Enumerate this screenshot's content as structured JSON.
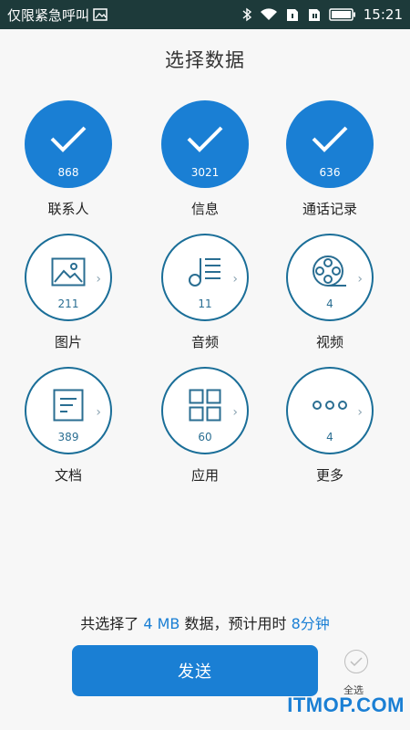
{
  "status_bar": {
    "left_text": "仅限紧急呼叫",
    "time": "15:21",
    "icons": [
      "image-icon",
      "bluetooth-icon",
      "wifi-icon",
      "sim1-icon",
      "sim2-icon",
      "battery-icon"
    ]
  },
  "title": "选择数据",
  "items": [
    {
      "label": "联系人",
      "count": "868",
      "state": "checked",
      "icon": "check-icon"
    },
    {
      "label": "信息",
      "count": "3021",
      "state": "checked",
      "icon": "check-icon"
    },
    {
      "label": "通话记录",
      "count": "636",
      "state": "checked",
      "icon": "check-icon"
    },
    {
      "label": "图片",
      "count": "211",
      "state": "unchecked",
      "icon": "picture-icon"
    },
    {
      "label": "音频",
      "count": "11",
      "state": "unchecked",
      "icon": "music-icon"
    },
    {
      "label": "视频",
      "count": "4",
      "state": "unchecked",
      "icon": "film-reel-icon"
    },
    {
      "label": "文档",
      "count": "389",
      "state": "unchecked",
      "icon": "document-icon"
    },
    {
      "label": "应用",
      "count": "60",
      "state": "unchecked",
      "icon": "apps-grid-icon"
    },
    {
      "label": "更多",
      "count": "4",
      "state": "unchecked",
      "icon": "more-dots-icon"
    }
  ],
  "summary": {
    "prefix": "共选择了",
    "size": "4 MB",
    "middle": "数据，预计用时",
    "time": "8分钟"
  },
  "send_button": "发送",
  "select_all": "全选",
  "watermark": "ITMOP.COM",
  "colors": {
    "accent": "#1a7fd4",
    "outline": "#1a6e98",
    "status_bar": "#1d3a3a",
    "background": "#f7f7f7"
  }
}
